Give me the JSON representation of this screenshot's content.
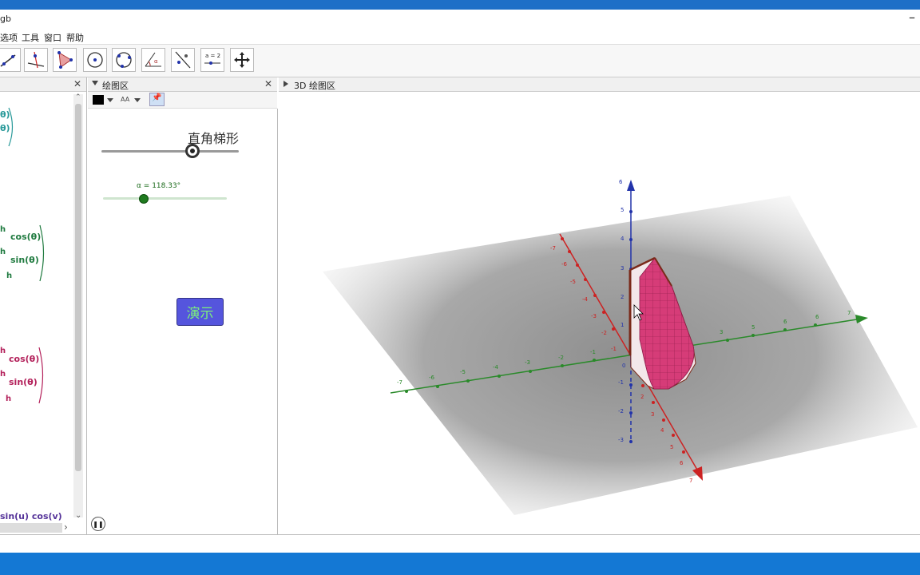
{
  "window": {
    "title": "gb",
    "min_glyph": "–"
  },
  "menu": {
    "items": [
      "选项",
      "工具",
      "窗口",
      "帮助"
    ]
  },
  "toolbar": {
    "icons": [
      "line-tool-icon",
      "perpendicular-tool-icon",
      "polygon-tool-icon",
      "circle-center-tool-icon",
      "circle-three-points-tool-icon",
      "angle-tool-icon",
      "reflect-tool-icon",
      "slider-tool-icon",
      "move-view-tool-icon"
    ],
    "slider_tool_label": "a = 2"
  },
  "algebra": {
    "close": "✕",
    "fragments": [
      {
        "text": "θ)",
        "color": "#2a9a9a"
      },
      {
        "text": "θ)",
        "color": "#2a9a9a"
      },
      {
        "text": "h",
        "color": "#1f7a3f"
      },
      {
        "text": "cos(θ)",
        "color": "#1f7a3f"
      },
      {
        "text": "h",
        "color": "#1f7a3f"
      },
      {
        "text": "sin(θ)",
        "color": "#1f7a3f"
      },
      {
        "text": "h",
        "color": "#1f7a3f"
      },
      {
        "text": "h",
        "color": "#b3205a"
      },
      {
        "text": "cos(θ)",
        "color": "#b3205a"
      },
      {
        "text": "h",
        "color": "#b3205a"
      },
      {
        "text": "sin(θ)",
        "color": "#b3205a"
      },
      {
        "text": "h",
        "color": "#b3205a"
      },
      {
        "text": "sin(u)  cos(v)",
        "color": "#553399"
      }
    ],
    "scroll_down": "⌄",
    "scroll_right": "›"
  },
  "graphics2d": {
    "title": "绘图区",
    "close": "✕",
    "slider_trapezoid": {
      "label": "直角梯形",
      "level": 0.66
    },
    "slider_alpha": {
      "label": "α = 118.33°",
      "level": 0.33
    },
    "demo_button": "演示",
    "pause": "❚❚"
  },
  "graphics3d": {
    "title": "3D 绘图区",
    "colors": {
      "x_axis": "#cc2222",
      "y_axis": "#2a8a2a",
      "z_axis": "#2233aa",
      "surface": "#d63c78",
      "trapezoid": "#ffffff"
    }
  }
}
